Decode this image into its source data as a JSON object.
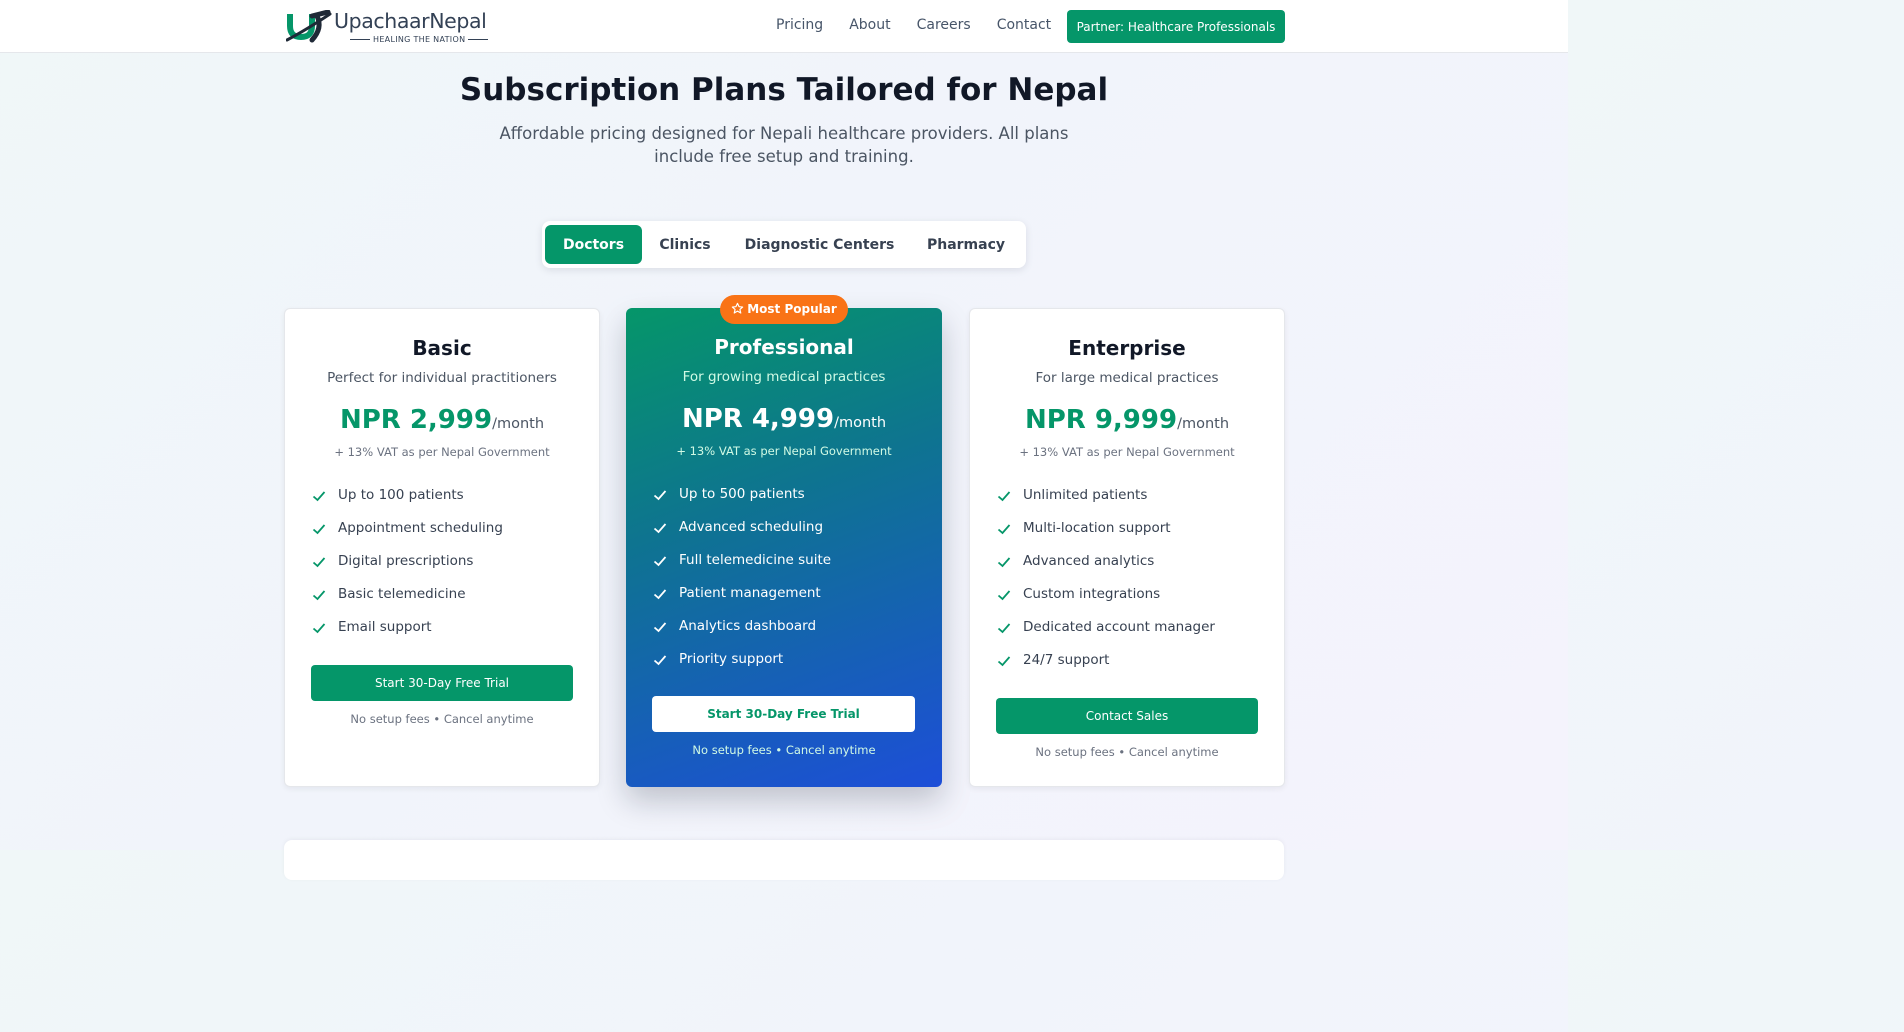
{
  "brand": {
    "name": "UpachaarNepal",
    "tagline": "HEALING THE NATION",
    "logo_icon": "upachaar-u-logo-icon",
    "colors": {
      "primary": "#059669",
      "accent": "#f97316",
      "featured_gradient_end": "#1d4ed8"
    }
  },
  "nav": {
    "items": [
      "Pricing",
      "About",
      "Careers",
      "Contact"
    ],
    "partner_button": "Partner: Healthcare Professionals"
  },
  "hero": {
    "title": "Subscription Plans Tailored for Nepal",
    "subtitle": "Affordable pricing designed for Nepali healthcare providers. All plans include free setup and training."
  },
  "tabs": {
    "items": [
      "Doctors",
      "Clinics",
      "Diagnostic Centers",
      "Pharmacy"
    ],
    "selected": "Doctors"
  },
  "plans": [
    {
      "name": "Basic",
      "description": "Perfect for individual practitioners",
      "price": "NPR 2,999",
      "period": "/month",
      "vat": "+ 13% VAT as per Nepal Government",
      "features": [
        "Up to 100 patients",
        "Appointment scheduling",
        "Digital prescriptions",
        "Basic telemedicine",
        "Email support"
      ],
      "cta": "Start 30-Day Free Trial",
      "note": "No setup fees • Cancel anytime"
    },
    {
      "name": "Professional",
      "badge": "Most Popular",
      "badge_icon": "star-icon",
      "description": "For growing medical practices",
      "price": "NPR 4,999",
      "period": "/month",
      "vat": "+ 13% VAT as per Nepal Government",
      "features": [
        "Up to 500 patients",
        "Advanced scheduling",
        "Full telemedicine suite",
        "Patient management",
        "Analytics dashboard",
        "Priority support"
      ],
      "cta": "Start 30-Day Free Trial",
      "note": "No setup fees • Cancel anytime"
    },
    {
      "name": "Enterprise",
      "description": "For large medical practices",
      "price": "NPR 9,999",
      "period": "/month",
      "vat": "+ 13% VAT as per Nepal Government",
      "features": [
        "Unlimited patients",
        "Multi-location support",
        "Advanced analytics",
        "Custom integrations",
        "Dedicated account manager",
        "24/7 support"
      ],
      "cta": "Contact Sales",
      "note": "No setup fees • Cancel anytime"
    }
  ]
}
